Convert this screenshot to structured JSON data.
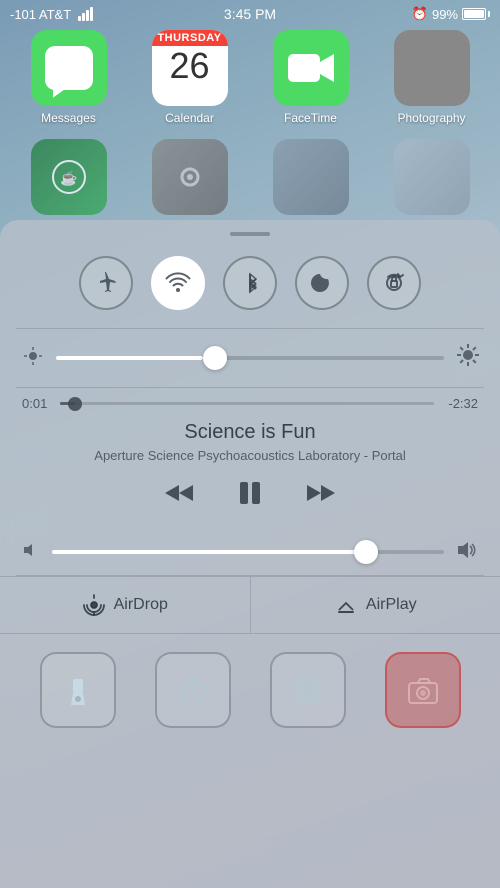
{
  "statusBar": {
    "carrier": "-101 AT&T",
    "time": "3:45 PM",
    "battery": "99%"
  },
  "homescreen": {
    "row1": [
      {
        "id": "messages",
        "label": "Messages"
      },
      {
        "id": "calendar",
        "label": "Calendar",
        "dayName": "Thursday",
        "dayNum": "26"
      },
      {
        "id": "facetime",
        "label": "FaceTime"
      },
      {
        "id": "photography",
        "label": "Photography"
      }
    ],
    "row2": [
      {
        "id": "starbucks",
        "label": ""
      },
      {
        "id": "settings",
        "label": ""
      },
      {
        "id": "unknown1",
        "label": ""
      },
      {
        "id": "folder1",
        "label": ""
      }
    ]
  },
  "controlCenter": {
    "handle": "",
    "toggles": [
      {
        "id": "airplane",
        "label": "Airplane Mode",
        "active": false
      },
      {
        "id": "wifi",
        "label": "WiFi",
        "active": true
      },
      {
        "id": "bluetooth",
        "label": "Bluetooth",
        "active": false
      },
      {
        "id": "donotdisturb",
        "label": "Do Not Disturb",
        "active": false
      },
      {
        "id": "rotation",
        "label": "Rotation Lock",
        "active": false
      }
    ],
    "brightness": {
      "value": 38
    },
    "media": {
      "elapsed": "0:01",
      "remaining": "-2:32",
      "title": "Science is Fun",
      "artist": "Aperture Science Psychoacoustics Laboratory - Portal"
    },
    "services": [
      {
        "id": "airdrop",
        "label": "AirDrop"
      },
      {
        "id": "airplay",
        "label": "AirPlay"
      }
    ],
    "quickActions": [
      {
        "id": "flashlight",
        "label": "Flashlight"
      },
      {
        "id": "timer",
        "label": "Timer"
      },
      {
        "id": "calculator",
        "label": "Calculator"
      },
      {
        "id": "camera",
        "label": "Camera"
      }
    ]
  }
}
